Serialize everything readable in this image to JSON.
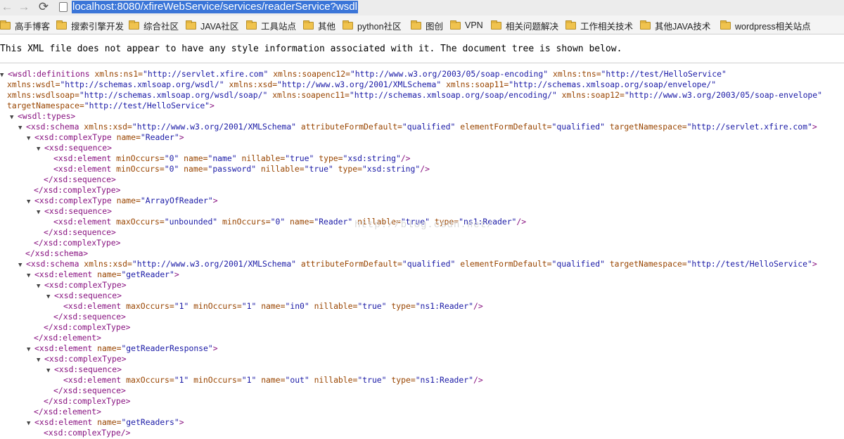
{
  "browser": {
    "url": "localhost:8080/xfireWebService/services/readerService?wsdl",
    "bookmarks": [
      "高手博客",
      "搜索引擎开发",
      "综合社区",
      "JAVA社区",
      "工具站点",
      "其他",
      "python社区",
      "图创",
      "VPN",
      "相关问题解决",
      "工作相关技术",
      "其他JAVA技术",
      "wordpress相关站点"
    ]
  },
  "notice": "This XML file does not appear to have any style information associated with it. The document tree is shown below.",
  "watermark": "http://blog.csdn.net/",
  "xml_lines": [
    [
      "▼ ",
      "<wsdl:definitions ",
      "xmlns:ns1=",
      "\"http://servlet.xfire.com\" ",
      "xmlns:soapenc12=",
      "\"http://www.w3.org/2003/05/soap-encoding\" ",
      "xmlns:tns=",
      "\"http://test/HelloService\""
    ],
    [
      "",
      "xmlns:wsdl=",
      "\"http://schemas.xmlsoap.org/wsdl/\" ",
      "xmlns:xsd=",
      "\"http://www.w3.org/2001/XMLSchema\" ",
      "xmlns:soap11=",
      "\"http://schemas.xmlsoap.org/soap/envelope/\""
    ],
    [
      "",
      "xmlns:wsdlsoap=",
      "\"http://schemas.xmlsoap.org/wsdl/soap/\" ",
      "xmlns:soapenc11=",
      "\"http://schemas.xmlsoap.org/soap/encoding/\" ",
      "xmlns:soap12=",
      "\"http://www.w3.org/2003/05/soap-envelope\""
    ],
    [
      "",
      "targetNamespace=",
      "\"http://test/HelloService\"",
      ">"
    ],
    [
      "▼ ",
      "<wsdl:types>"
    ],
    [
      "▼ ",
      "<xsd:schema ",
      "xmlns:xsd=",
      "\"http://www.w3.org/2001/XMLSchema\" ",
      "attributeFormDefault=",
      "\"qualified\" ",
      "elementFormDefault=",
      "\"qualified\" ",
      "targetNamespace=",
      "\"http://servlet.xfire.com\"",
      ">"
    ],
    [
      "▼ ",
      "<xsd:complexType ",
      "name=",
      "\"Reader\"",
      ">"
    ],
    [
      "▼ ",
      "<xsd:sequence>"
    ],
    [
      "",
      "<xsd:element ",
      "minOccurs=",
      "\"0\" ",
      "name=",
      "\"name\" ",
      "nillable=",
      "\"true\" ",
      "type=",
      "\"xsd:string\"",
      "/>"
    ],
    [
      "",
      "<xsd:element ",
      "minOccurs=",
      "\"0\" ",
      "name=",
      "\"password\" ",
      "nillable=",
      "\"true\" ",
      "type=",
      "\"xsd:string\"",
      "/>"
    ],
    [
      "",
      "</xsd:sequence>"
    ],
    [
      "",
      "</xsd:complexType>"
    ],
    [
      "▼ ",
      "<xsd:complexType ",
      "name=",
      "\"ArrayOfReader\"",
      ">"
    ],
    [
      "▼ ",
      "<xsd:sequence>"
    ],
    [
      "",
      "<xsd:element ",
      "maxOccurs=",
      "\"unbounded\" ",
      "minOccurs=",
      "\"0\" ",
      "name=",
      "\"Reader\" ",
      "nillable=",
      "\"true\" ",
      "type=",
      "\"ns1:Reader\"",
      "/>"
    ],
    [
      "",
      "</xsd:sequence>"
    ],
    [
      "",
      "</xsd:complexType>"
    ],
    [
      "",
      "</xsd:schema>"
    ],
    [
      "▼ ",
      "<xsd:schema ",
      "xmlns:xsd=",
      "\"http://www.w3.org/2001/XMLSchema\" ",
      "attributeFormDefault=",
      "\"qualified\" ",
      "elementFormDefault=",
      "\"qualified\" ",
      "targetNamespace=",
      "\"http://test/HelloService\"",
      ">"
    ],
    [
      "▼ ",
      "<xsd:element ",
      "name=",
      "\"getReader\"",
      ">"
    ],
    [
      "▼ ",
      "<xsd:complexType>"
    ],
    [
      "▼ ",
      "<xsd:sequence>"
    ],
    [
      "",
      "<xsd:element ",
      "maxOccurs=",
      "\"1\" ",
      "minOccurs=",
      "\"1\" ",
      "name=",
      "\"in0\" ",
      "nillable=",
      "\"true\" ",
      "type=",
      "\"ns1:Reader\"",
      "/>"
    ],
    [
      "",
      "</xsd:sequence>"
    ],
    [
      "",
      "</xsd:complexType>"
    ],
    [
      "",
      "</xsd:element>"
    ],
    [
      "▼ ",
      "<xsd:element ",
      "name=",
      "\"getReaderResponse\"",
      ">"
    ],
    [
      "▼ ",
      "<xsd:complexType>"
    ],
    [
      "▼ ",
      "<xsd:sequence>"
    ],
    [
      "",
      "<xsd:element ",
      "maxOccurs=",
      "\"1\" ",
      "minOccurs=",
      "\"1\" ",
      "name=",
      "\"out\" ",
      "nillable=",
      "\"true\" ",
      "type=",
      "\"ns1:Reader\"",
      "/>"
    ],
    [
      "",
      "</xsd:sequence>"
    ],
    [
      "",
      "</xsd:complexType>"
    ],
    [
      "",
      "</xsd:element>"
    ],
    [
      "▼ ",
      "<xsd:element ",
      "name=",
      "\"getReaders\"",
      ">"
    ],
    [
      "",
      "<xsd:complexType/>"
    ]
  ]
}
